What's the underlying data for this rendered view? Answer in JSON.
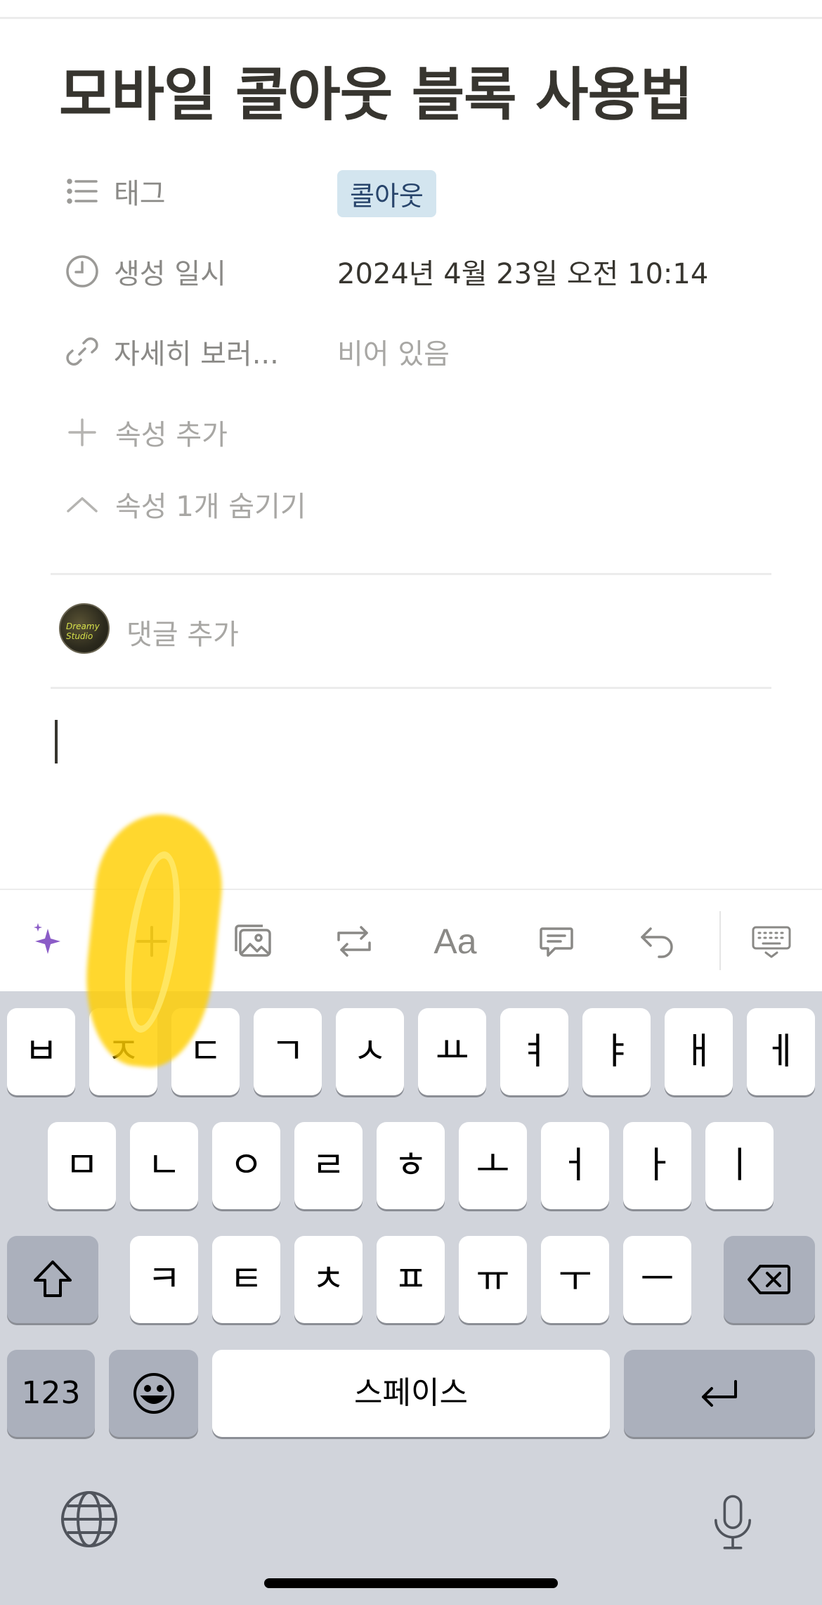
{
  "page": {
    "title": "모바일 콜아웃 블록 사용법"
  },
  "properties": [
    {
      "icon": "list-icon",
      "label": "태그",
      "value": "콜아웃",
      "type": "tag"
    },
    {
      "icon": "clock-icon",
      "label": "생성 일시",
      "value": "2024년 4월 23일 오전 10:14",
      "type": "text"
    },
    {
      "icon": "link-icon",
      "label": "자세히 보러...",
      "value": "비어 있음",
      "type": "empty"
    }
  ],
  "actions": {
    "add_property": "속성 추가",
    "hide_properties": "속성 1개 숨기기"
  },
  "comment": {
    "placeholder": "댓글 추가",
    "avatar_text": "Dreamy Studio"
  },
  "toolbar": {
    "items": [
      "ai-sparkle-icon",
      "plus-icon",
      "image-icon",
      "turn-into-icon",
      "text-style",
      "comment-icon",
      "undo-icon",
      "keyboard-hide-icon"
    ],
    "text_style_label": "Aa"
  },
  "keyboard": {
    "row1": [
      "ㅂ",
      "ㅈ",
      "ㄷ",
      "ㄱ",
      "ㅅ",
      "ㅛ",
      "ㅕ",
      "ㅑ",
      "ㅐ",
      "ㅔ"
    ],
    "row2": [
      "ㅁ",
      "ㄴ",
      "ㅇ",
      "ㄹ",
      "ㅎ",
      "ㅗ",
      "ㅓ",
      "ㅏ",
      "ㅣ"
    ],
    "row3": [
      "ㅋ",
      "ㅌ",
      "ㅊ",
      "ㅍ",
      "ㅠ",
      "ㅜ",
      "ㅡ"
    ],
    "numbers_label": "123",
    "space_label": "스페이스"
  },
  "colors": {
    "tag_bg": "#d3e5ef",
    "tag_text": "#28456c",
    "sparkle": "#8b5cc7",
    "highlight": "#ffce00",
    "keyboard_bg": "#d1d4db"
  }
}
